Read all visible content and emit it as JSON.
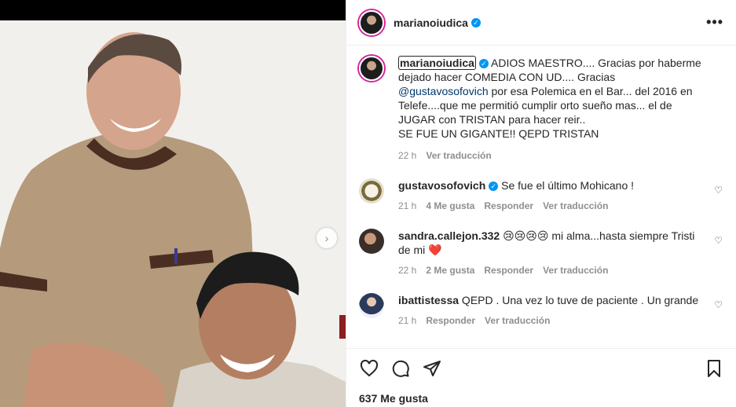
{
  "post": {
    "author": "marianoiudica",
    "more_label": "•••",
    "likes_text": "637 Me gusta",
    "carousel_next": "›"
  },
  "caption": {
    "username": "marianoiudica",
    "line1": " ADIOS MAESTRO.... Gracias por haberme dejado hacer COMEDIA CON UD.... Gracias ",
    "mention": "@gustavosofovich",
    "line2": " por esa Polemica en el Bar... del 2016 en Telefe....que me permitió cumplir orto sueño mas... el de JUGAR con TRISTAN para hacer reir..",
    "line3": "SE FUE UN GIGANTE!! QEPD TRISTAN",
    "time": "22 h",
    "translate": "Ver traducción"
  },
  "comments": [
    {
      "username": "gustavosofovich",
      "verified": true,
      "text": " Se fue el último Mohicano !",
      "time": "21 h",
      "likes": "4 Me gusta",
      "reply": "Responder",
      "translate": "Ver traducción"
    },
    {
      "username": "sandra.callejon.332",
      "verified": false,
      "text": " 😢😢😢😢 mi alma...hasta siempre Tristi de mi ❤️",
      "time": "22 h",
      "likes": "2 Me gusta",
      "reply": "Responder",
      "translate": "Ver traducción"
    },
    {
      "username": "ibattistessa",
      "verified": false,
      "text": " QEPD . Una vez lo tuve de paciente . Un grande",
      "time": "21 h",
      "reply": "Responder",
      "translate": "Ver traducción"
    }
  ],
  "icons": {
    "heart": "♡",
    "verified": "✓"
  },
  "colors": {
    "verified": "#0095f6",
    "mention": "#00376b",
    "muted": "#8e8e8e"
  }
}
